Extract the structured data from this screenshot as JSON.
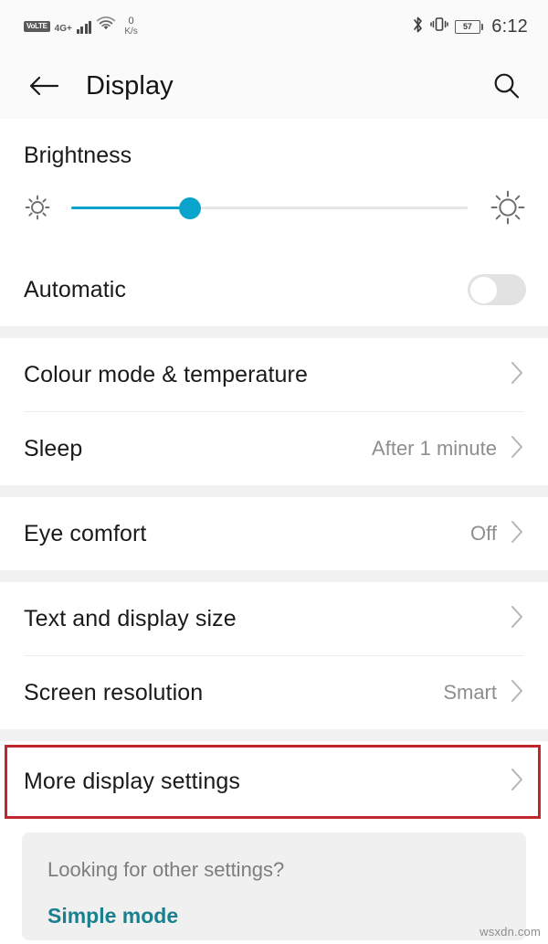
{
  "statusbar": {
    "volte_label": "VoLTE",
    "network_label": "4G+",
    "signal_icon": "signal-bars-icon",
    "wifi_icon": "wifi-icon",
    "data_speed_value": "0",
    "data_speed_unit": "K/s",
    "bluetooth_icon": "bluetooth-icon",
    "vibrate_icon": "vibrate-icon",
    "battery_percent": "57",
    "time": "6:12"
  },
  "header": {
    "back_icon": "back-arrow-icon",
    "title": "Display",
    "search_icon": "search-icon"
  },
  "brightness": {
    "label": "Brightness",
    "low_icon": "sun-low-icon",
    "high_icon": "sun-high-icon",
    "slider_percent": 30,
    "accent_color": "#0aa3cc"
  },
  "automatic": {
    "label": "Automatic",
    "toggle_state": "off"
  },
  "sections": [
    {
      "rows": [
        {
          "label": "Colour mode & temperature",
          "value": "",
          "chevron": "chevron-right-icon"
        },
        {
          "label": "Sleep",
          "value": "After 1 minute",
          "chevron": "chevron-right-icon"
        }
      ]
    },
    {
      "rows": [
        {
          "label": "Eye comfort",
          "value": "Off",
          "chevron": "chevron-right-icon"
        }
      ]
    },
    {
      "rows": [
        {
          "label": "Text and display size",
          "value": "",
          "chevron": "chevron-right-icon"
        },
        {
          "label": "Screen resolution",
          "value": "Smart",
          "chevron": "chevron-right-icon"
        }
      ]
    }
  ],
  "highlighted_row": {
    "label": "More display settings",
    "chevron": "chevron-right-icon",
    "highlight_color": "#c0272d"
  },
  "footer": {
    "question": "Looking for other settings?",
    "link_label": "Simple mode",
    "link_color": "#1a7f8e"
  },
  "watermark": "wsxdn.com"
}
